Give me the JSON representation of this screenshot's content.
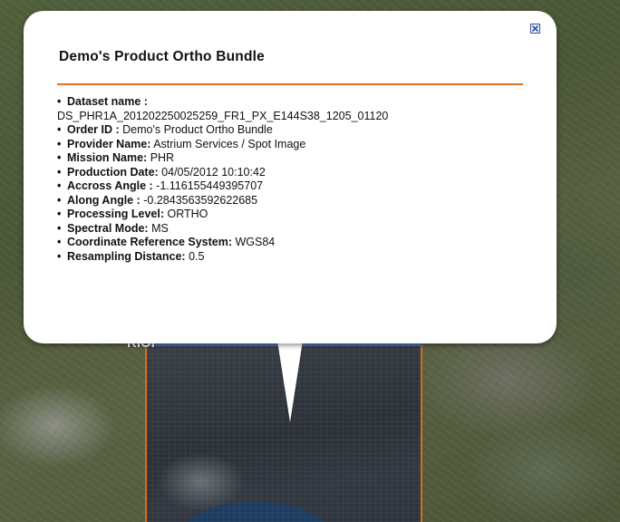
{
  "popup": {
    "title": "Demo's Product Ortho Bundle",
    "close_icon": "close-icon",
    "fields": [
      {
        "label": "Dataset name :",
        "value": ""
      },
      {
        "label": "",
        "value": "DS_PHR1A_201202250025259_FR1_PX_E144S38_1205_01120"
      },
      {
        "label": "Order ID :",
        "value": " Demo's Product Ortho Bundle"
      },
      {
        "label": "Provider Name:",
        "value": " Astrium Services / Spot Image"
      },
      {
        "label": "Mission Name:",
        "value": " PHR"
      },
      {
        "label": "Production Date:",
        "value": " 04/05/2012 10:10:42"
      },
      {
        "label": "Accross Angle :",
        "value": " -1.116155449395707"
      },
      {
        "label": "Along Angle :",
        "value": " -0.2843563592622685"
      },
      {
        "label": "Processing Level:",
        "value": " ORTHO"
      },
      {
        "label": "Spectral Mode:",
        "value": " MS"
      },
      {
        "label": "Coordinate Reference System:",
        "value": " WGS84"
      },
      {
        "label": "Resampling Distance:",
        "value": " 0.5"
      }
    ]
  },
  "map": {
    "label": "KIOI",
    "overlay_border_color": "#d96a1e",
    "rule_color": "#e0702a"
  }
}
